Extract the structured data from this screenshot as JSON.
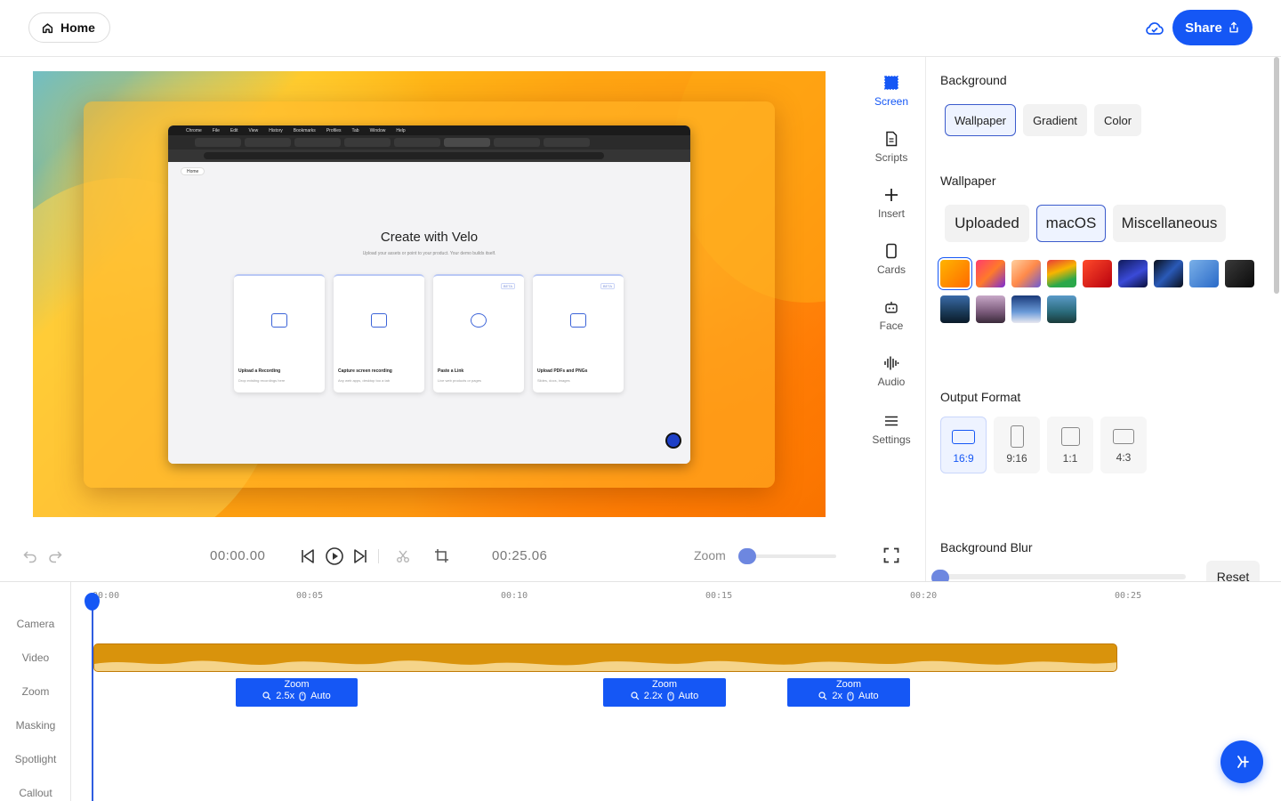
{
  "header": {
    "home_label": "Home",
    "share_label": "Share"
  },
  "preview": {
    "browser_menu": [
      "Chrome",
      "File",
      "Edit",
      "View",
      "History",
      "Bookmarks",
      "Profiles",
      "Tab",
      "Window",
      "Help"
    ],
    "browser_home": "Home",
    "page_title": "Create with Velo",
    "page_subtitle": "Upload your assets or point to your product. Your demo builds itself.",
    "cards": [
      {
        "title": "Upload a Recording",
        "subtitle": "Drop existing recordings here",
        "badge": ""
      },
      {
        "title": "Capture screen recording",
        "subtitle": "Any web apps, desktop too a tab",
        "badge": ""
      },
      {
        "title": "Paste a Link",
        "subtitle": "Live web products or pages",
        "badge": "BETA"
      },
      {
        "title": "Upload PDFs and PNGs",
        "subtitle": "Slides, docs, images",
        "badge": "BETA"
      }
    ]
  },
  "tools": [
    {
      "label": "Screen",
      "icon": "screen-icon",
      "active": true
    },
    {
      "label": "Scripts",
      "icon": "document-icon",
      "active": false
    },
    {
      "label": "Insert",
      "icon": "plus-icon",
      "active": false
    },
    {
      "label": "Cards",
      "icon": "card-icon",
      "active": false
    },
    {
      "label": "Face",
      "icon": "robot-face-icon",
      "active": false
    },
    {
      "label": "Audio",
      "icon": "waveform-icon",
      "active": false
    },
    {
      "label": "Settings",
      "icon": "menu-lines-icon",
      "active": false
    }
  ],
  "controls": {
    "current_time": "00:00.00",
    "total_time": "00:25.06",
    "zoom_label": "Zoom",
    "zoom_value": 0
  },
  "panel": {
    "background_title": "Background",
    "background_tabs": [
      "Wallpaper",
      "Gradient",
      "Color"
    ],
    "background_selected": "Wallpaper",
    "wallpaper_title": "Wallpaper",
    "wallpaper_tabs": [
      "Uploaded",
      "macOS",
      "Miscellaneous"
    ],
    "wallpaper_selected": "macOS",
    "wallpaper_count": 13,
    "output_title": "Output Format",
    "formats": [
      "16:9",
      "9:16",
      "1:1",
      "4:3"
    ],
    "format_selected": "16:9",
    "blur_title": "Background Blur",
    "blur_value": 0,
    "reset_label": "Reset"
  },
  "timeline": {
    "tracks": [
      "Camera",
      "Video",
      "Zoom",
      "Masking",
      "Spotlight",
      "Callout"
    ],
    "ticks": [
      "00:00",
      "00:05",
      "00:10",
      "00:15",
      "00:20",
      "00:25"
    ],
    "playhead": "00:00",
    "zoom_blocks": [
      {
        "label": "Zoom",
        "level": "2.5x",
        "mode": "Auto"
      },
      {
        "label": "Zoom",
        "level": "2.2x",
        "mode": "Auto"
      },
      {
        "label": "Zoom",
        "level": "2x",
        "mode": "Auto"
      }
    ]
  },
  "colors": {
    "accent": "#1557f5",
    "clip": "#d9930c"
  }
}
